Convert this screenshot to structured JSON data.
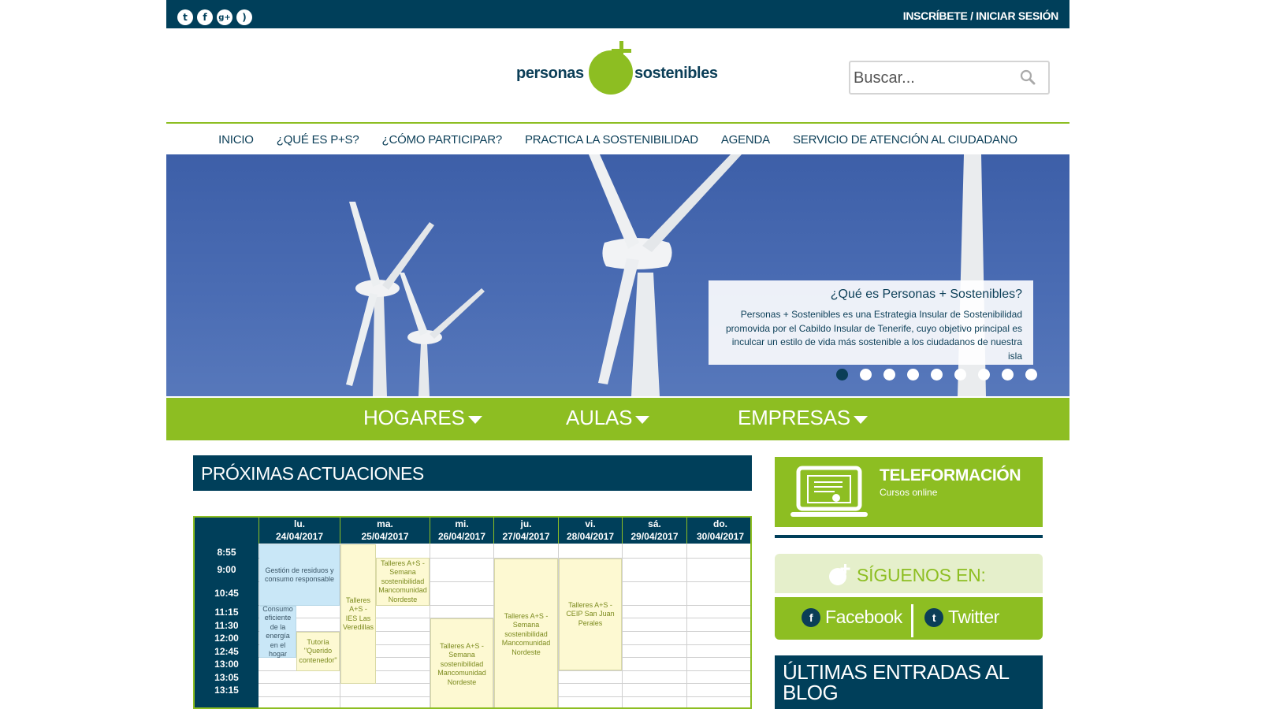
{
  "topbar": {
    "social_icons": [
      "twitter-icon",
      "facebook-icon",
      "google-plus-icon",
      "rss-icon"
    ],
    "login_label": "INSCRÍBETE / INICIAR SESIÓN"
  },
  "logo": {
    "word1": "personas",
    "word2": "sostenibles"
  },
  "search": {
    "placeholder": "Buscar..."
  },
  "nav": {
    "items": [
      "INICIO",
      "¿QUÉ ES P+S?",
      "¿CÓMO PARTICIPAR?",
      "PRACTICA LA SOSTENIBILIDAD",
      "AGENDA",
      "SERVICIO DE ATENCIÓN AL CIUDADANO"
    ]
  },
  "hero": {
    "caption_title": "¿Qué es Personas + Sostenibles?",
    "caption_body": "Personas + Sostenibles es una Estrategia Insular de Sostenibilidad promovida por el Cabildo Insular de Tenerife, cuyo objetivo principal es inculcar un estilo de vida más sostenible a los ciudadanos de nuestra isla",
    "slide_count": 9,
    "active_slide": 1
  },
  "categories": [
    "HOGARES",
    "AULAS",
    "EMPRESAS"
  ],
  "agenda": {
    "title": "PRÓXIMAS ACTUACIONES",
    "days": [
      {
        "name": "lu.",
        "date": "24/04/2017"
      },
      {
        "name": "ma.",
        "date": "25/04/2017"
      },
      {
        "name": "mi.",
        "date": "26/04/2017"
      },
      {
        "name": "ju.",
        "date": "27/04/2017"
      },
      {
        "name": "vi.",
        "date": "28/04/2017"
      },
      {
        "name": "sá.",
        "date": "29/04/2017"
      },
      {
        "name": "do.",
        "date": "30/04/2017"
      }
    ],
    "times": [
      "8:55",
      "9:00",
      "10:45",
      "11:15",
      "11:30",
      "12:00",
      "12:45",
      "13:00",
      "13:05",
      "13:15"
    ],
    "events": [
      "Gestión de residuos y consumo responsable",
      "Consumo eficiente de la energía en el hogar",
      "Tutoría \"Querido contenedor\"",
      "Talleres A+S - IES Las Veredillas",
      "Talleres A+S - Semana sostenibilidad Mancomunidad Nordeste",
      "Talleres A+S - Semana sostenibilidad Mancomunidad Nordeste",
      "Talleres A+S - Semana sostenibilidad Mancomunidad Nordeste",
      "Talleres A+S - CEIP San Juan Perales"
    ]
  },
  "sidebar": {
    "teleformacion_title": "TELEFORMACIÓN",
    "teleformacion_sub": "Cursos online",
    "follow_title": "SÍGUENOS EN:",
    "facebook_label": "Facebook",
    "twitter_label": "Twitter",
    "blog_title": "ÚLTIMAS ENTRADAS AL BLOG"
  },
  "colors": {
    "navy": "#003f5a",
    "green": "#8dbe22",
    "event_blue": "#c9e7f7",
    "event_yellow": "#fdf9d2"
  }
}
